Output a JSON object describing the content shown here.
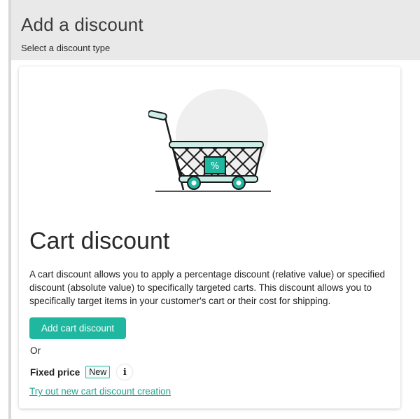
{
  "header": {
    "title": "Add a discount",
    "subtitle": "Select a discount type"
  },
  "card": {
    "illustration_icon": "shopping-cart-percent-icon",
    "title": "Cart discount",
    "description": "A cart discount allows you to apply a percentage discount (relative value) or specified discount (absolute value) to specifically targeted carts. This discount allows you to specifically target items in your customer's cart or their cost for shipping.",
    "primary_button_label": "Add cart discount",
    "or_text": "Or",
    "fixed_price_label": "Fixed price",
    "new_badge": "New",
    "info_icon": "info-icon",
    "cart_badge_text": "%",
    "link_text": "Try out new cart discount creation"
  },
  "colors": {
    "accent": "#1fb7a0",
    "header_bg": "#e9e9e9",
    "link": "#1fa590"
  }
}
